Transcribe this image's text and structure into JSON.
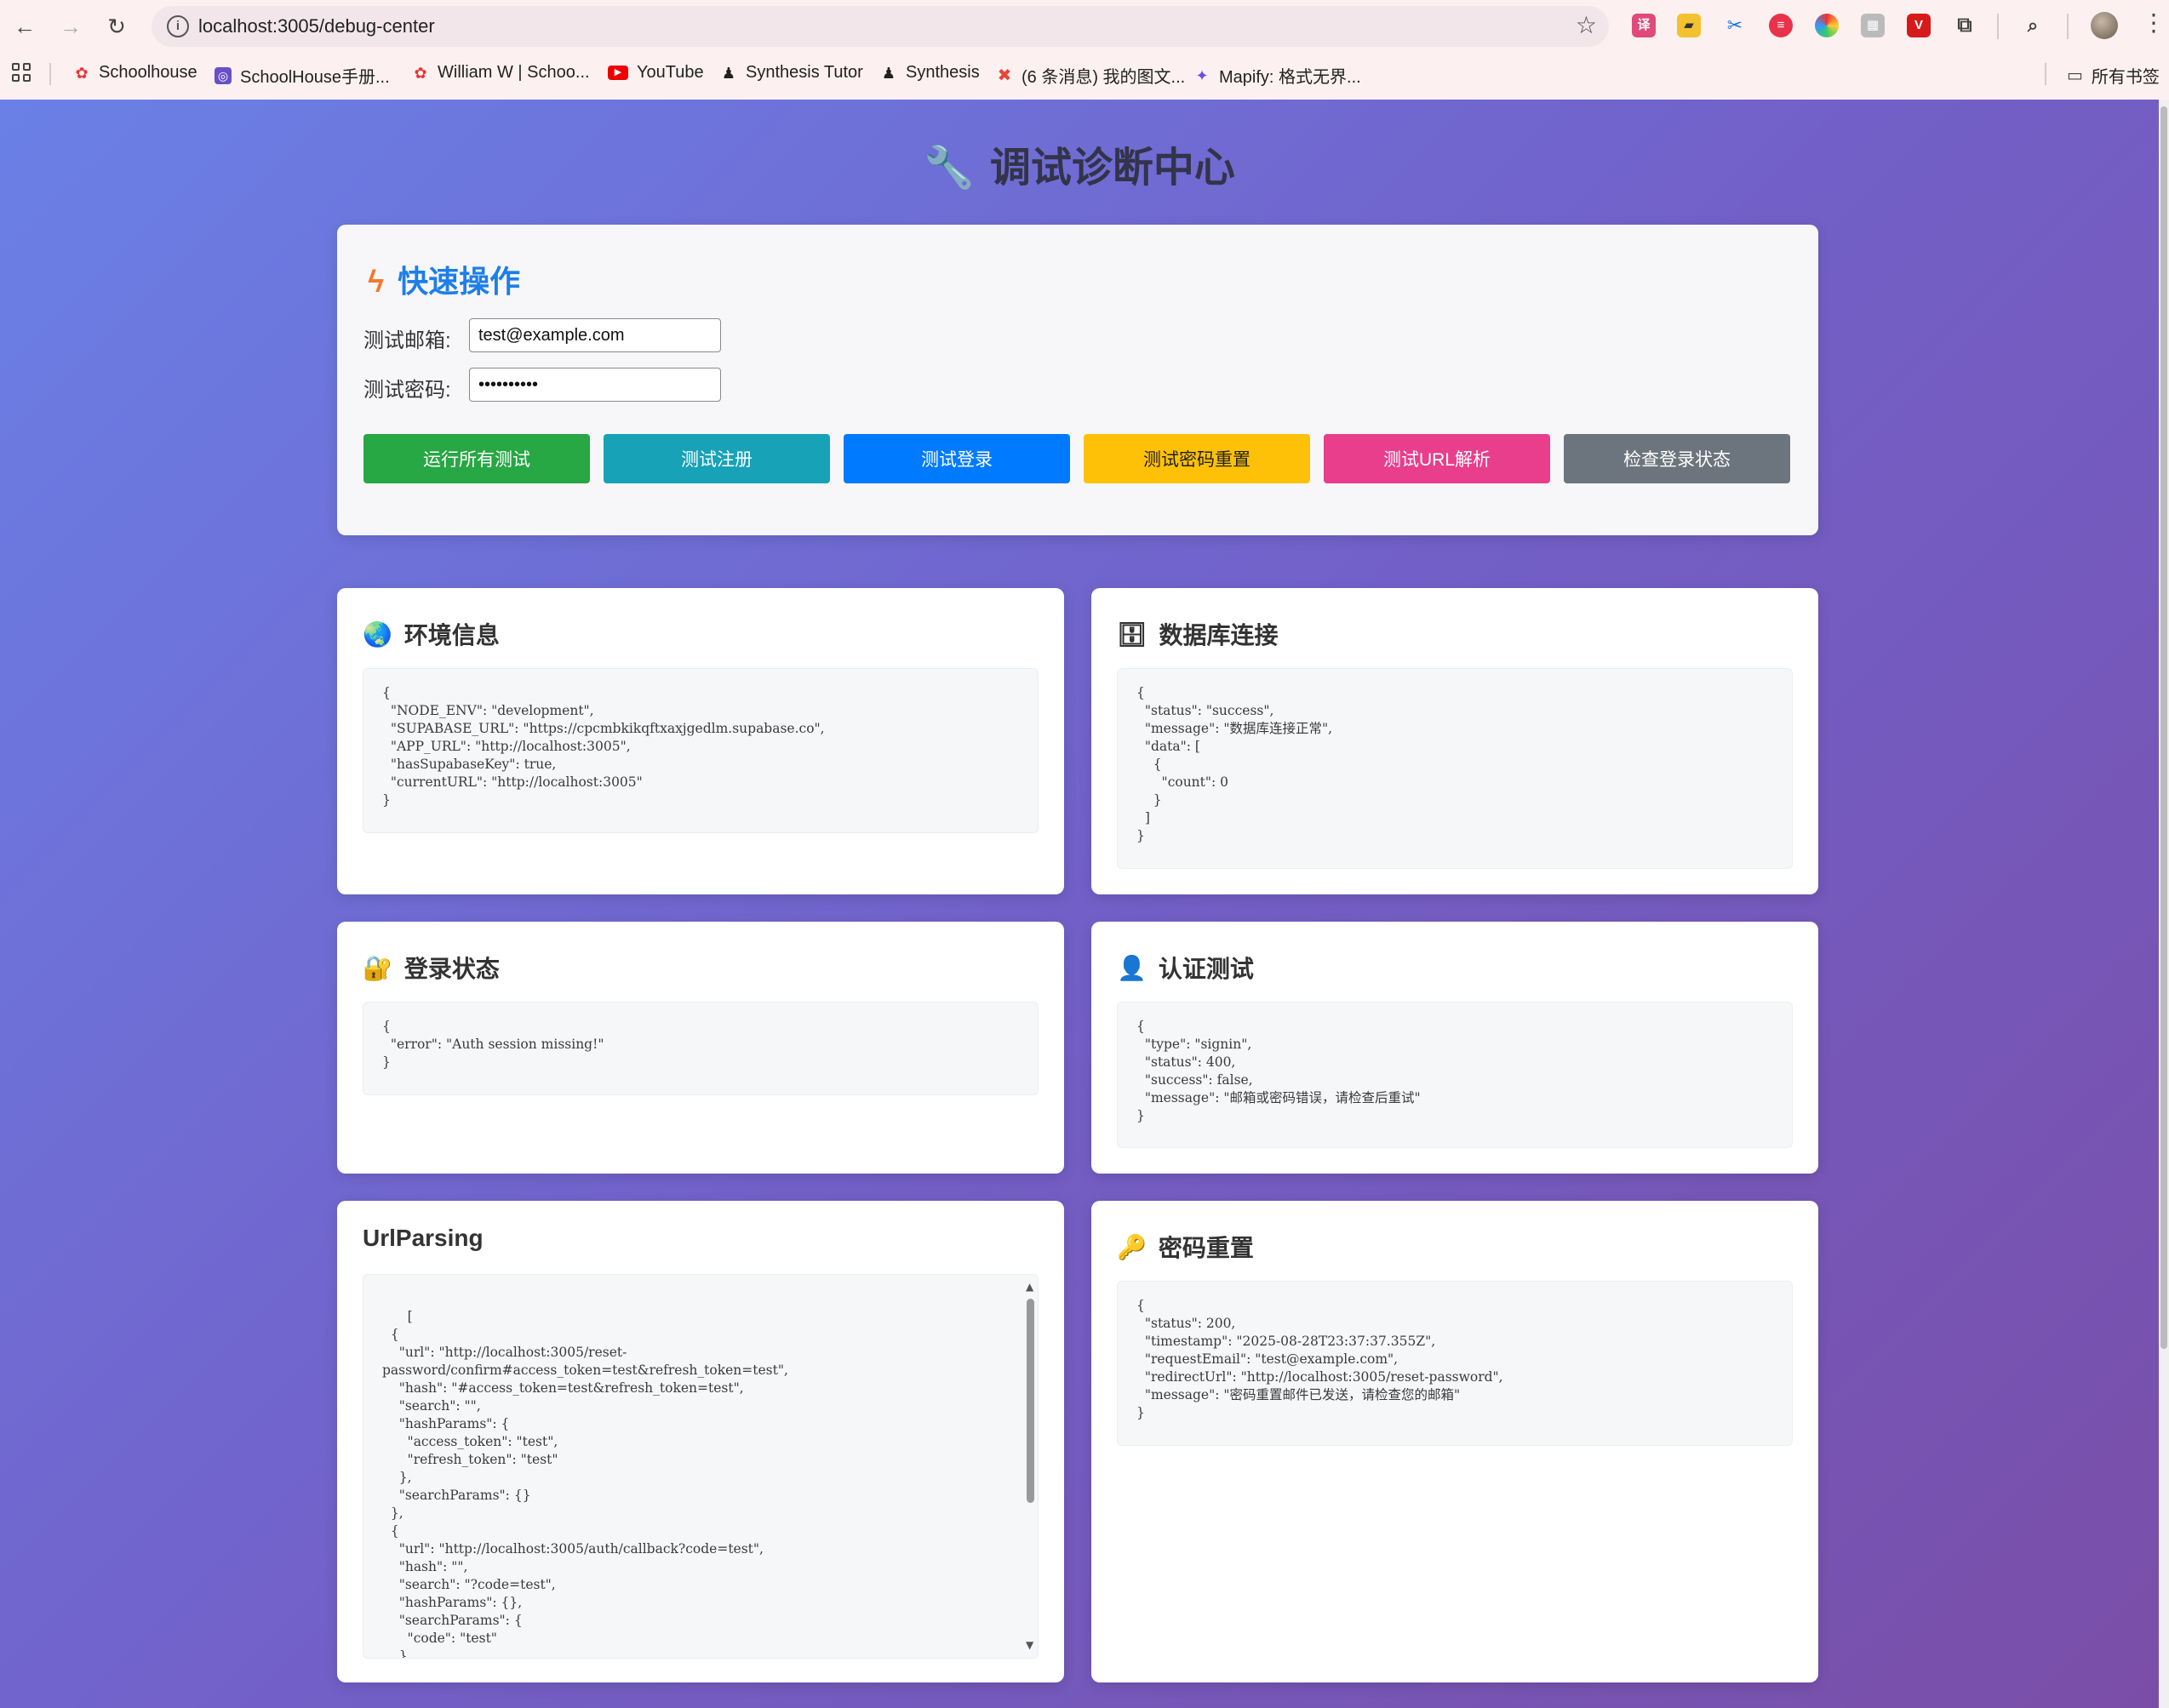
{
  "browser": {
    "url": "localhost:3005/debug-center",
    "bookmarks": [
      "Schoolhouse",
      "SchoolHouse手册...",
      "William W | Schoo...",
      "YouTube",
      "Synthesis Tutor",
      "Synthesis",
      "(6 条消息) 我的图文...",
      "Mapify: 格式无界..."
    ],
    "all_bookmarks": "所有书签"
  },
  "page": {
    "title": "调试诊断中心"
  },
  "quick": {
    "title": "快速操作",
    "email_label": "测试邮箱:",
    "email_value": "test@example.com",
    "password_label": "测试密码:",
    "password_value": "password12",
    "buttons": [
      {
        "label": "运行所有测试",
        "color": "#28a745"
      },
      {
        "label": "测试注册",
        "color": "#17a2b8"
      },
      {
        "label": "测试登录",
        "color": "#007bff"
      },
      {
        "label": "测试密码重置",
        "color": "#ffc107"
      },
      {
        "label": "测试URL解析",
        "color": "#e83e8c"
      },
      {
        "label": "检查登录状态",
        "color": "#6c757d"
      }
    ]
  },
  "cards": {
    "env": {
      "title": "环境信息",
      "icon": "globe-icon",
      "json": "{\n  \"NODE_ENV\": \"development\",\n  \"SUPABASE_URL\": \"https://cpcmbkikqftxaxjgedlm.supabase.co\",\n  \"APP_URL\": \"http://localhost:3005\",\n  \"hasSupabaseKey\": true,\n  \"currentURL\": \"http://localhost:3005\"\n}"
    },
    "db": {
      "title": "数据库连接",
      "icon": "database-icon",
      "json": "{\n  \"status\": \"success\",\n  \"message\": \"数据库连接正常\",\n  \"data\": [\n    {\n      \"count\": 0\n    }\n  ]\n}"
    },
    "login": {
      "title": "登录状态",
      "icon": "lock-icon",
      "json": "{\n  \"error\": \"Auth session missing!\"\n}"
    },
    "auth": {
      "title": "认证测试",
      "icon": "user-icon",
      "json": "{\n  \"type\": \"signin\",\n  \"status\": 400,\n  \"success\": false,\n  \"message\": \"邮箱或密码错误，请检查后重试\"\n}"
    },
    "url": {
      "title": "UrlParsing",
      "json": "[\n  {\n    \"url\": \"http://localhost:3005/reset-\npassword/confirm#access_token=test&refresh_token=test\",\n    \"hash\": \"#access_token=test&refresh_token=test\",\n    \"search\": \"\",\n    \"hashParams\": {\n      \"access_token\": \"test\",\n      \"refresh_token\": \"test\"\n    },\n    \"searchParams\": {}\n  },\n  {\n    \"url\": \"http://localhost:3005/auth/callback?code=test\",\n    \"hash\": \"\",\n    \"search\": \"?code=test\",\n    \"hashParams\": {},\n    \"searchParams\": {\n      \"code\": \"test\"\n    }\n  },"
    },
    "reset": {
      "title": "密码重置",
      "icon": "key-icon",
      "json": "{\n  \"status\": 200,\n  \"timestamp\": \"2025-08-28T23:37:37.355Z\",\n  \"requestEmail\": \"test@example.com\",\n  \"redirectUrl\": \"http://localhost:3005/reset-password\",\n  \"message\": \"密码重置邮件已发送，请检查您的邮箱\"\n}"
    }
  }
}
